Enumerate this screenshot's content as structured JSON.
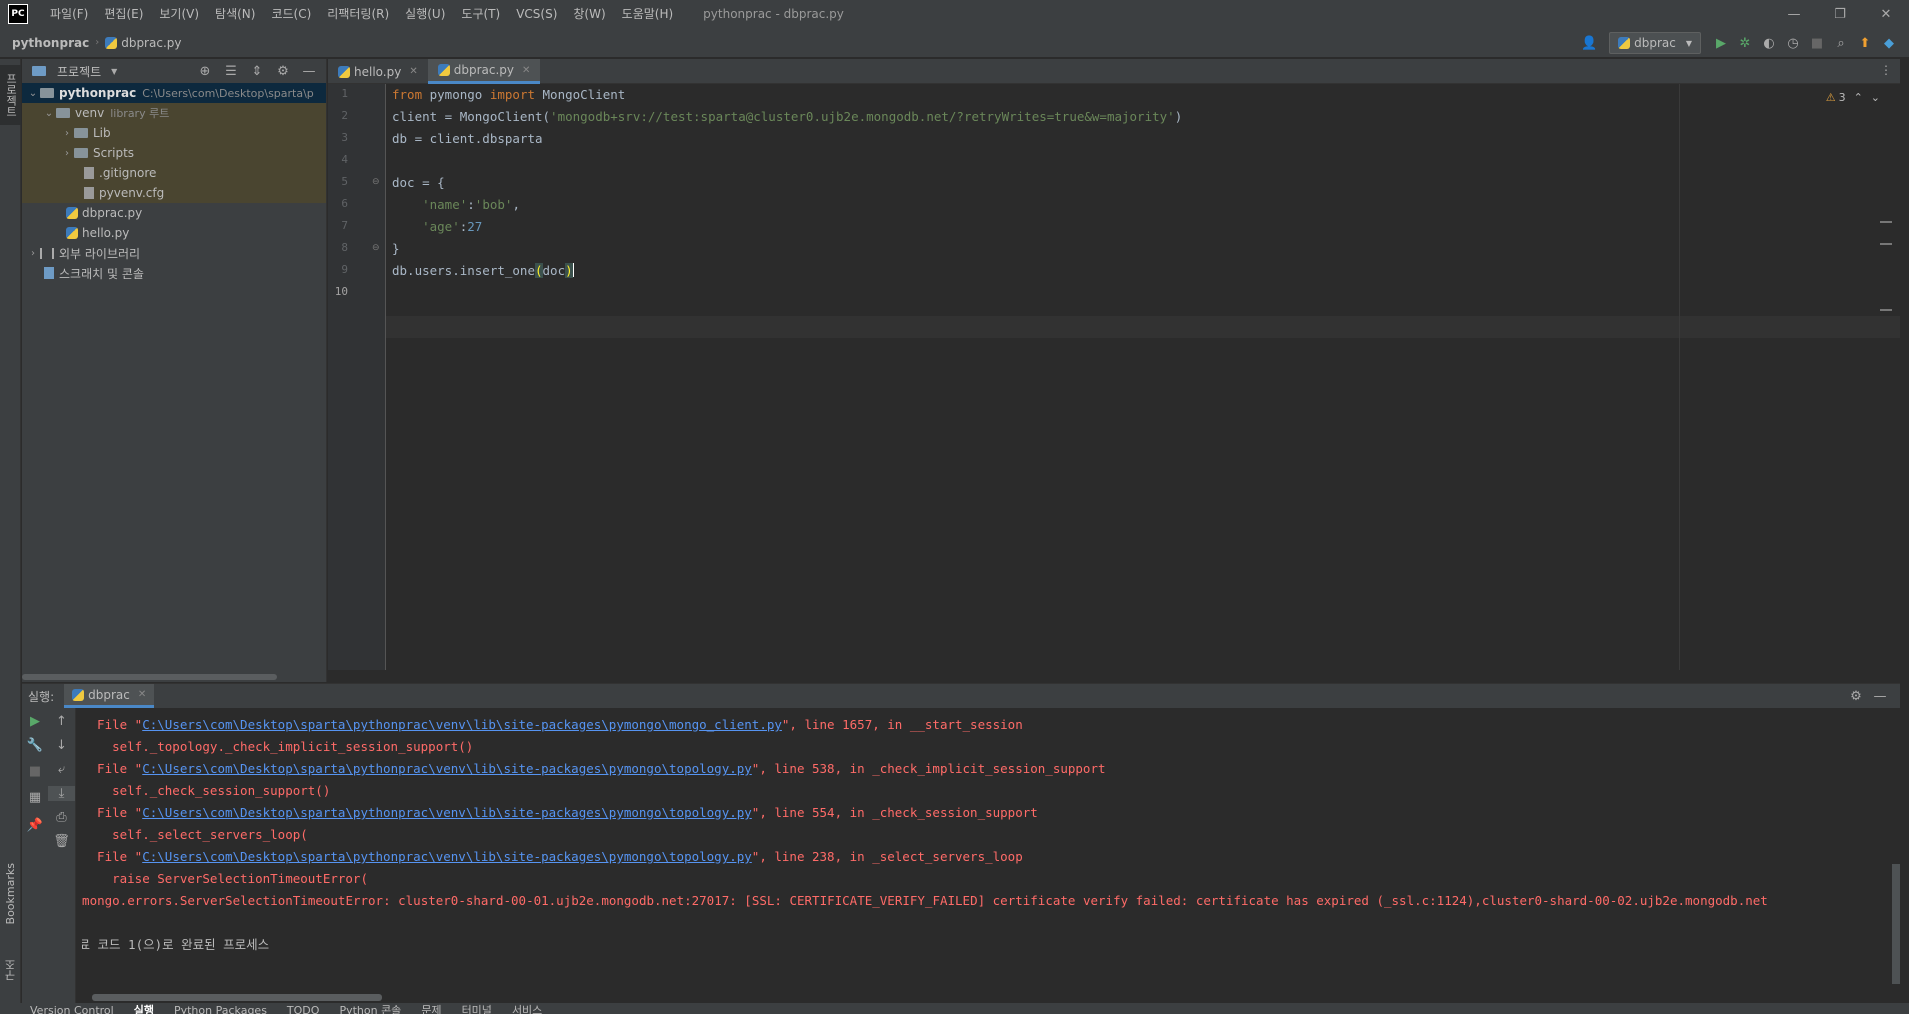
{
  "titlebar": {
    "logo": "PC",
    "menus": [
      "파일(F)",
      "편집(E)",
      "보기(V)",
      "탐색(N)",
      "코드(C)",
      "리팩터링(R)",
      "실행(U)",
      "도구(T)",
      "VCS(S)",
      "창(W)",
      "도움말(H)"
    ],
    "window_title": "pythonprac - dbprac.py"
  },
  "navbar": {
    "project": "pythonprac",
    "file": "dbprac.py",
    "run_config": "dbprac"
  },
  "left_stripe": {
    "project_tab": "프로젝트",
    "bookmarks_tab": "Bookmarks",
    "structure_tab": "구조"
  },
  "project_panel": {
    "title": "프로젝트",
    "tree": [
      {
        "label": "pythonprac",
        "hint": "C:\\Users\\com\\Desktop\\sparta\\p",
        "type": "root"
      },
      {
        "label": "venv",
        "hint": "library 루트",
        "type": "folder"
      },
      {
        "label": "Lib",
        "type": "folder"
      },
      {
        "label": "Scripts",
        "type": "folder"
      },
      {
        "label": ".gitignore",
        "type": "file"
      },
      {
        "label": "pyvenv.cfg",
        "type": "file"
      },
      {
        "label": "dbprac.py",
        "type": "py"
      },
      {
        "label": "hello.py",
        "type": "py"
      },
      {
        "label": "외부 라이브러리",
        "type": "lib"
      },
      {
        "label": "스크래치 및 콘솔",
        "type": "scratch"
      }
    ]
  },
  "editor": {
    "tabs": [
      {
        "label": "hello.py",
        "active": false
      },
      {
        "label": "dbprac.py",
        "active": true
      }
    ],
    "line_numbers": [
      "1",
      "2",
      "3",
      "4",
      "5",
      "6",
      "7",
      "8",
      "9",
      "10"
    ],
    "code": {
      "l1_from": "from",
      "l1_mod": " pymongo ",
      "l1_import": "import",
      "l1_rest": " MongoClient",
      "l2_pre": "client = MongoClient(",
      "l2_str": "'mongodb+srv://test:sparta@cluster0.ujb2e.mongodb.net/?retryWrites=true&w=majority'",
      "l2_post": ")",
      "l3": "db = client.dbsparta",
      "l5": "doc = {",
      "l6_key": "    'name'",
      "l6_colon": ":",
      "l6_val": "'bob'",
      "l6_end": ",",
      "l7_key": "    'age'",
      "l7_colon": ":",
      "l7_val": "27",
      "l8": "}",
      "l10_pre": "db.users.insert_one",
      "l10_open": "(",
      "l10_arg": "doc",
      "l10_close": ")"
    },
    "inspection_count": "3"
  },
  "run_panel": {
    "label": "실행:",
    "tab": "dbprac",
    "console": [
      {
        "pre": "  File \"",
        "link": "C:\\Users\\com\\Desktop\\sparta\\pythonprac\\venv\\lib\\site-packages\\pymongo\\mongo_client.py",
        "post": "\", line 1657, in __start_session"
      },
      {
        "text": "    self._topology._check_implicit_session_support()"
      },
      {
        "pre": "  File \"",
        "link": "C:\\Users\\com\\Desktop\\sparta\\pythonprac\\venv\\lib\\site-packages\\pymongo\\topology.py",
        "post": "\", line 538, in _check_implicit_session_support"
      },
      {
        "text": "    self._check_session_support()"
      },
      {
        "pre": "  File \"",
        "link": "C:\\Users\\com\\Desktop\\sparta\\pythonprac\\venv\\lib\\site-packages\\pymongo\\topology.py",
        "post": "\", line 554, in _check_session_support"
      },
      {
        "text": "    self._select_servers_loop("
      },
      {
        "pre": "  File \"",
        "link": "C:\\Users\\com\\Desktop\\sparta\\pythonprac\\venv\\lib\\site-packages\\pymongo\\topology.py",
        "post": "\", line 238, in _select_servers_loop"
      },
      {
        "text": "    raise ServerSelectionTimeoutError("
      },
      {
        "text": "pymongo.errors.ServerSelectionTimeoutError: cluster0-shard-00-01.ujb2e.mongodb.net:27017: [SSL: CERTIFICATE_VERIFY_FAILED] certificate verify failed: certificate has expired (_ssl.c:1124),cluster0-shard-00-02.ujb2e.mongodb.net"
      }
    ],
    "exit_message": "종료 코드 1(으)로 완료된 프로세스"
  },
  "statusbar": {
    "tabs": [
      "Version Control",
      "실행",
      "Python Packages",
      "TODO",
      "Python 콘솔",
      "문제",
      "터미널",
      "서비스"
    ]
  }
}
